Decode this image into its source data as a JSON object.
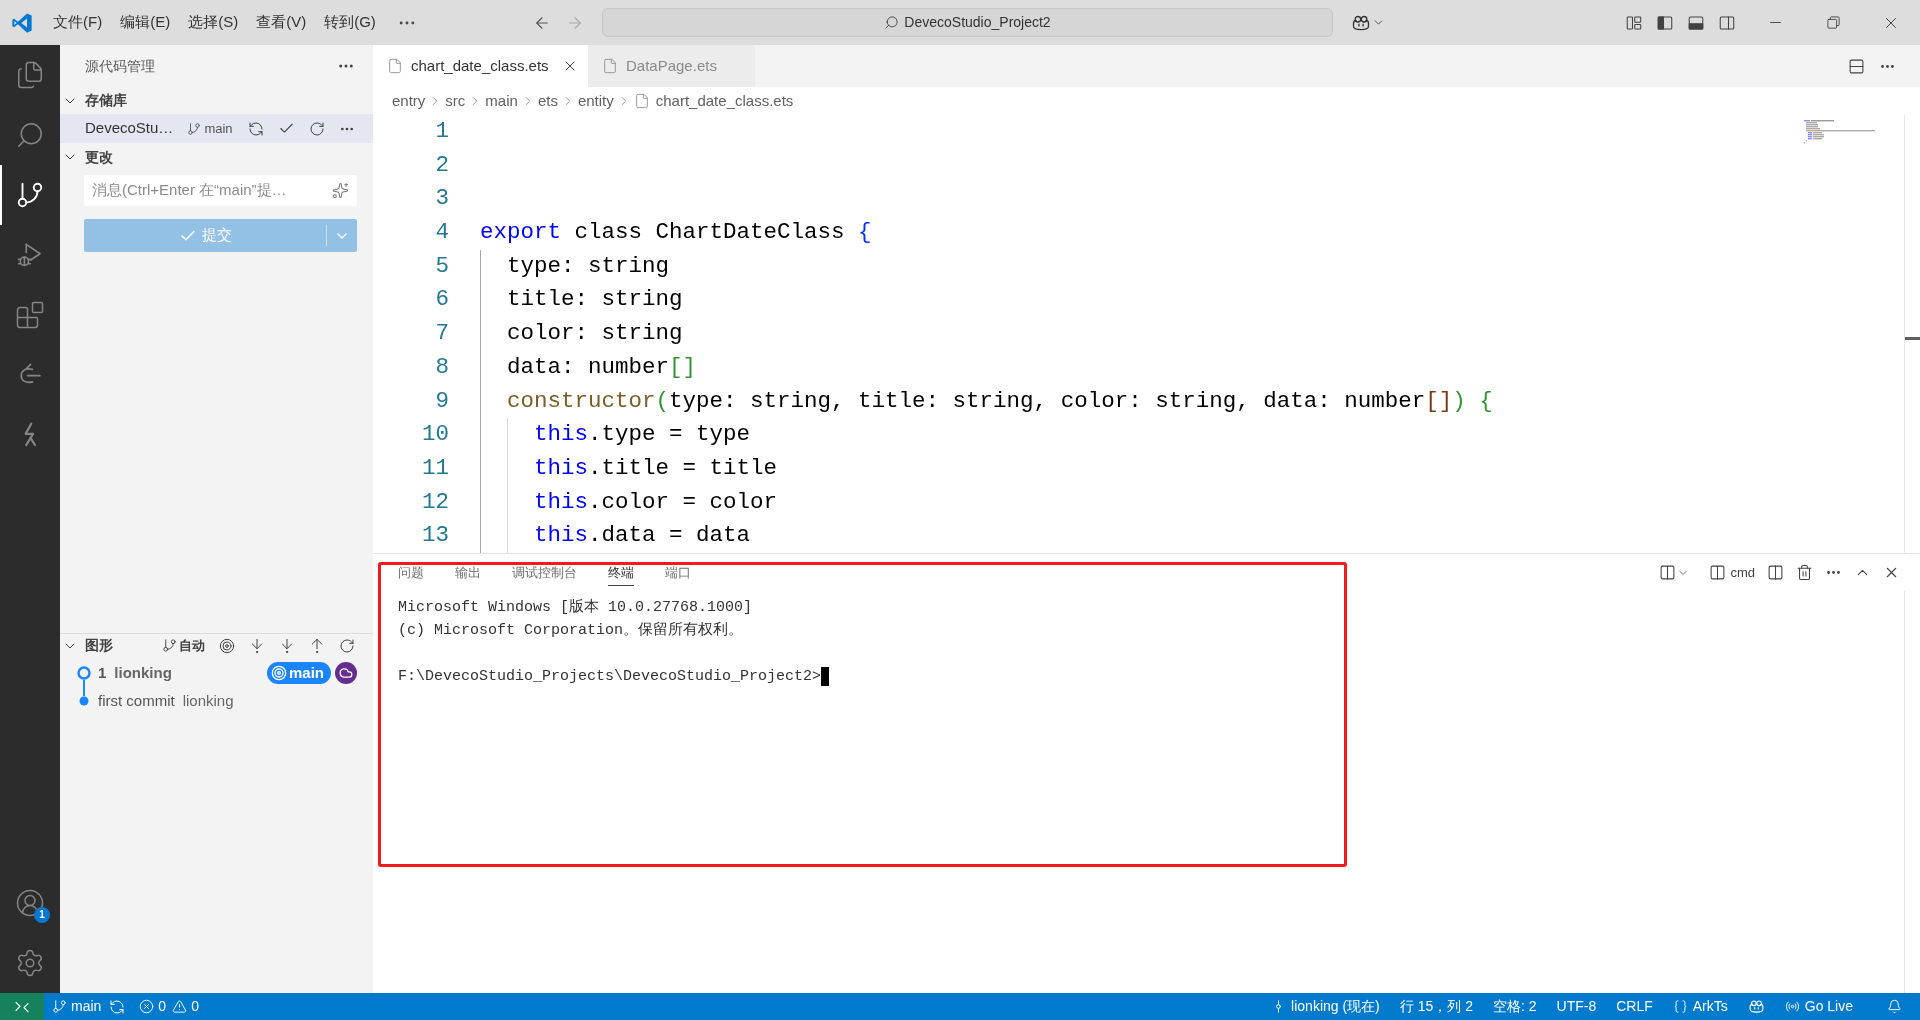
{
  "title_bar": {
    "menus": [
      "文件(F)",
      "编辑(E)",
      "选择(S)",
      "查看(V)",
      "转到(G)"
    ],
    "search": {
      "value": "DevecoStudio_Project2"
    }
  },
  "activity_bar": {
    "items": [
      {
        "selected": false
      },
      {
        "selected": false
      },
      {
        "selected": true
      },
      {
        "selected": false
      },
      {
        "selected": false
      },
      {
        "selected": false
      },
      {
        "selected": false
      }
    ],
    "account_badge": "1"
  },
  "sidebar": {
    "title": "源代码管理",
    "repositories": {
      "title": "存储库",
      "expanded": true,
      "items": [
        {
          "name": "DevecoStu…",
          "branch": "main",
          "selected": true
        }
      ]
    },
    "changes": {
      "title": "更改",
      "expanded": true,
      "message": {
        "placeholder": "消息(Ctrl+Enter 在“main”提…"
      },
      "commit": {
        "label": "提交",
        "disabled": true
      }
    },
    "graph": {
      "title": "图形",
      "expanded": true,
      "mode": "自动",
      "commits": [
        {
          "message": "1",
          "author": "lionking",
          "head": true,
          "refs": [
            {
              "kind": "branch",
              "label": "main"
            },
            {
              "kind": "remote"
            }
          ]
        },
        {
          "message": "first commit",
          "author": "lionking",
          "head": false
        }
      ]
    }
  },
  "editor": {
    "tabs": [
      {
        "label": "chart_date_class.ets",
        "selected": true
      },
      {
        "label": "DataPage.ets",
        "selected": false
      }
    ],
    "breadcrumbs": [
      "entry",
      "src",
      "main",
      "ets",
      "entity",
      "chart_date_class.ets"
    ],
    "lines": [
      {
        "number": "1"
      },
      {
        "number": "2"
      },
      {
        "number": "3"
      },
      {
        "number": "4",
        "tokens": [
          {
            "kind": "keyword",
            "text": "export"
          },
          {
            "kind": "text",
            "text": " class ChartDateClass "
          },
          {
            "kind": "bracket1",
            "text": "{"
          }
        ]
      },
      {
        "number": "5",
        "tokens": [
          {
            "kind": "text",
            "text": "  type: string"
          }
        ]
      },
      {
        "number": "6",
        "tokens": [
          {
            "kind": "text",
            "text": "  title: string"
          }
        ]
      },
      {
        "number": "7",
        "tokens": [
          {
            "kind": "text",
            "text": "  color: string"
          }
        ]
      },
      {
        "number": "8",
        "tokens": [
          {
            "kind": "text",
            "text": "  data: number"
          },
          {
            "kind": "bracket2",
            "text": "[]"
          }
        ]
      },
      {
        "number": "9",
        "tokens": [
          {
            "kind": "function",
            "text": "  constructor"
          },
          {
            "kind": "bracket2",
            "text": "("
          },
          {
            "kind": "text",
            "text": "type: string, title: string, color: string, data: number"
          },
          {
            "kind": "bracket3",
            "text": "[]"
          },
          {
            "kind": "bracket2",
            "text": ")"
          },
          {
            "kind": "bracket2",
            "text": " {"
          }
        ]
      },
      {
        "number": "10",
        "tokens": [
          {
            "kind": "keyword",
            "text": "    this"
          },
          {
            "kind": "text",
            "text": ".type = type"
          }
        ]
      },
      {
        "number": "11",
        "tokens": [
          {
            "kind": "keyword",
            "text": "    this"
          },
          {
            "kind": "text",
            "text": ".title = title"
          }
        ]
      },
      {
        "number": "12",
        "tokens": [
          {
            "kind": "keyword",
            "text": "    this"
          },
          {
            "kind": "text",
            "text": ".color = color"
          }
        ]
      },
      {
        "number": "13",
        "tokens": [
          {
            "kind": "keyword",
            "text": "    this"
          },
          {
            "kind": "text",
            "text": ".data = data"
          }
        ]
      }
    ]
  },
  "panel": {
    "tabs": [
      {
        "label": "问题",
        "selected": false
      },
      {
        "label": "输出",
        "selected": false
      },
      {
        "label": "调试控制台",
        "selected": false
      },
      {
        "label": "终端",
        "selected": true
      },
      {
        "label": "端口",
        "selected": false
      }
    ],
    "terminal_name": "cmd",
    "terminal": {
      "output": [
        "Microsoft Windows [版本 10.0.27768.1000]",
        "(c) Microsoft Corporation。保留所有权利。"
      ],
      "prompt": "F:\\DevecoStudio_Projects\\DevecoStudio_Project2>"
    }
  },
  "status_bar": {
    "branch": "main",
    "errors": "0",
    "warnings": "0",
    "items": [
      "lionking (现在)",
      "行 15，列 2",
      "空格: 2",
      "UTF-8",
      "CRLF",
      "ArkTs",
      "Go Live"
    ]
  }
}
